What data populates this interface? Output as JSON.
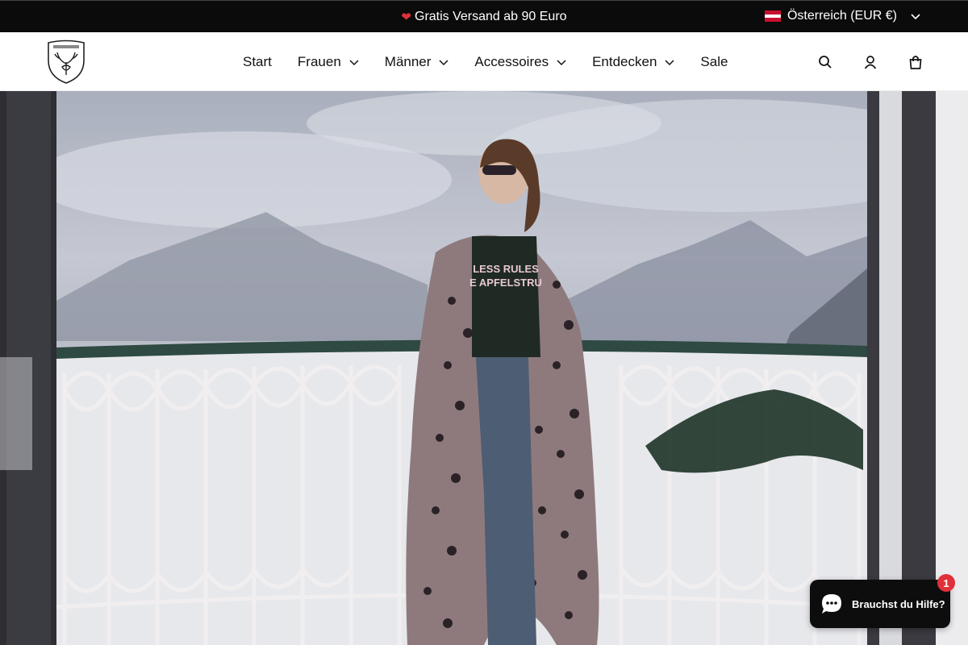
{
  "announcement": {
    "heart_icon": "heart-icon",
    "text": "Gratis Versand ab 90 Euro",
    "heart_color": "#e0313a"
  },
  "country_selector": {
    "label": "Österreich (EUR €)",
    "flag_icon": "austria-flag-icon",
    "flag_colors": [
      "#c8102e",
      "#ffffff",
      "#c8102e"
    ]
  },
  "header": {
    "logo_icon": "deer-crest-logo",
    "nav": [
      {
        "label": "Start",
        "has_dropdown": false
      },
      {
        "label": "Frauen",
        "has_dropdown": true
      },
      {
        "label": "Männer",
        "has_dropdown": true
      },
      {
        "label": "Accessoires",
        "has_dropdown": true
      },
      {
        "label": "Entdecken",
        "has_dropdown": true
      },
      {
        "label": "Sale",
        "has_dropdown": false
      }
    ],
    "icons": [
      "search-icon",
      "account-icon",
      "cart-icon"
    ]
  },
  "hero": {
    "shirt_line1": "LESS RULES",
    "shirt_line2": "E APFELSTRU"
  },
  "chat": {
    "label": "Brauchst du Hilfe?",
    "badge_count": "1",
    "icon": "chat-bubble-icon"
  }
}
